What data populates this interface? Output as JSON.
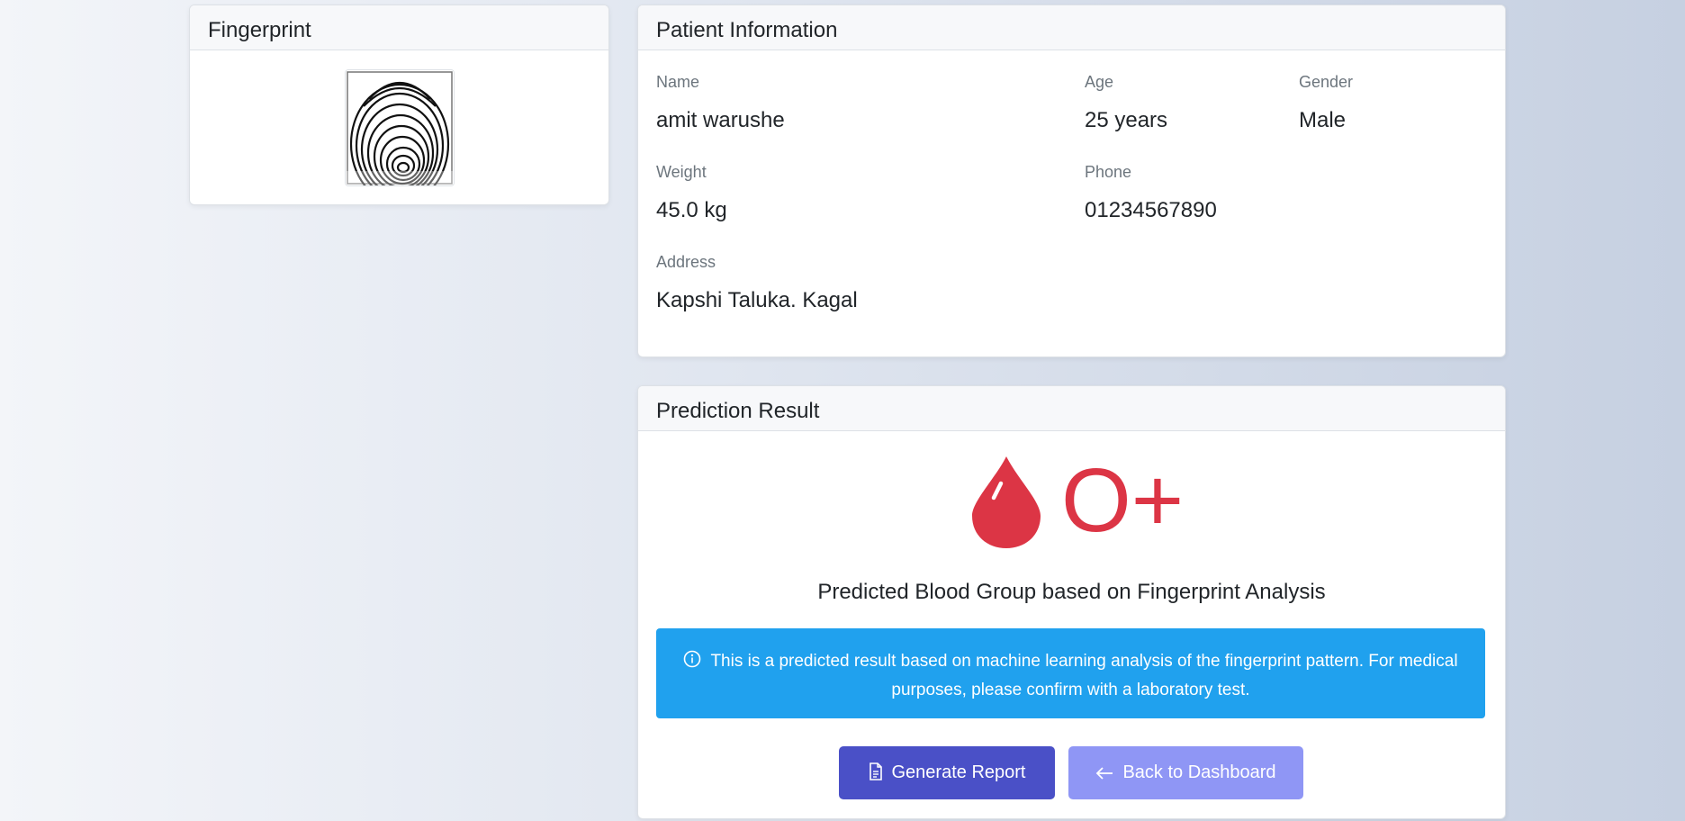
{
  "fingerprint": {
    "header": "Fingerprint"
  },
  "patient": {
    "header": "Patient Information",
    "name_label": "Name",
    "name_value": "amit warushe",
    "age_label": "Age",
    "age_value": "25 years",
    "gender_label": "Gender",
    "gender_value": "Male",
    "weight_label": "Weight",
    "weight_value": "45.0 kg",
    "phone_label": "Phone",
    "phone_value": "01234567890",
    "address_label": "Address",
    "address_value": "Kapshi Taluka. Kagal"
  },
  "prediction": {
    "header": "Prediction Result",
    "blood_group": "O+",
    "caption": "Predicted Blood Group based on Fingerprint Analysis",
    "info_text": "This is a predicted result based on machine learning analysis of the fingerprint pattern. For medical purposes, please confirm with a laboratory test.",
    "generate_label": "Generate Report",
    "back_label": "Back to Dashboard"
  },
  "colors": {
    "accent_red": "#dc3545",
    "info_blue": "#20a1ee",
    "primary_button": "#4a50c7",
    "secondary_button": "#8f96f5"
  },
  "icons": {
    "blood": "droplet-icon",
    "info": "info-circle-icon",
    "report": "document-icon",
    "back": "arrow-left-icon"
  }
}
